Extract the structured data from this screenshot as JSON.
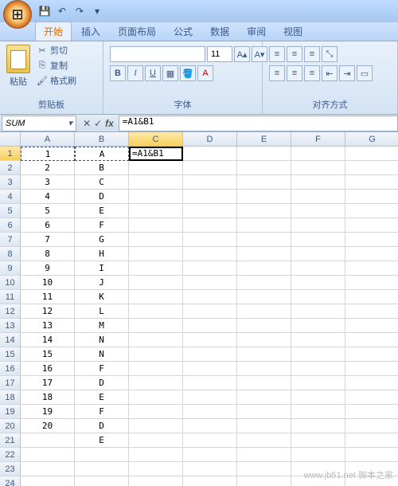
{
  "qat": {
    "save": "💾",
    "undo": "↶",
    "redo": "↷",
    "dd": "▾"
  },
  "tabs": [
    "开始",
    "插入",
    "页面布局",
    "公式",
    "数据",
    "审阅",
    "视图"
  ],
  "active_tab": 0,
  "ribbon": {
    "clipboard": {
      "title": "剪贴板",
      "paste": "粘贴",
      "cut": "剪切",
      "copy": "复制",
      "format": "格式刷"
    },
    "font": {
      "title": "字体",
      "size": "11",
      "bold": "B",
      "italic": "I",
      "underline": "U"
    },
    "align": {
      "title": "对齐方式"
    }
  },
  "name_box": "SUM",
  "formula_bar_btns": {
    "cancel": "✕",
    "ok": "✓",
    "fx": "fx"
  },
  "formula": "=A1&B1",
  "editing_cell_text": "=A1&B1",
  "columns": [
    "A",
    "B",
    "C",
    "D",
    "E",
    "F",
    "G"
  ],
  "active_col": 2,
  "active_row": 0,
  "marquee": [
    [
      0,
      0
    ],
    [
      0,
      1
    ]
  ],
  "rows": [
    {
      "n": 1,
      "c": [
        "1",
        "A",
        "",
        "",
        "",
        "",
        ""
      ]
    },
    {
      "n": 2,
      "c": [
        "2",
        "B",
        "",
        "",
        "",
        "",
        ""
      ]
    },
    {
      "n": 3,
      "c": [
        "3",
        "C",
        "",
        "",
        "",
        "",
        ""
      ]
    },
    {
      "n": 4,
      "c": [
        "4",
        "D",
        "",
        "",
        "",
        "",
        ""
      ]
    },
    {
      "n": 5,
      "c": [
        "5",
        "E",
        "",
        "",
        "",
        "",
        ""
      ]
    },
    {
      "n": 6,
      "c": [
        "6",
        "F",
        "",
        "",
        "",
        "",
        ""
      ]
    },
    {
      "n": 7,
      "c": [
        "7",
        "G",
        "",
        "",
        "",
        "",
        ""
      ]
    },
    {
      "n": 8,
      "c": [
        "8",
        "H",
        "",
        "",
        "",
        "",
        ""
      ]
    },
    {
      "n": 9,
      "c": [
        "9",
        "I",
        "",
        "",
        "",
        "",
        ""
      ]
    },
    {
      "n": 10,
      "c": [
        "10",
        "J",
        "",
        "",
        "",
        "",
        ""
      ]
    },
    {
      "n": 11,
      "c": [
        "11",
        "K",
        "",
        "",
        "",
        "",
        ""
      ]
    },
    {
      "n": 12,
      "c": [
        "12",
        "L",
        "",
        "",
        "",
        "",
        ""
      ]
    },
    {
      "n": 13,
      "c": [
        "13",
        "M",
        "",
        "",
        "",
        "",
        ""
      ]
    },
    {
      "n": 14,
      "c": [
        "14",
        "N",
        "",
        "",
        "",
        "",
        ""
      ]
    },
    {
      "n": 15,
      "c": [
        "15",
        "N",
        "",
        "",
        "",
        "",
        ""
      ]
    },
    {
      "n": 16,
      "c": [
        "16",
        "F",
        "",
        "",
        "",
        "",
        ""
      ]
    },
    {
      "n": 17,
      "c": [
        "17",
        "D",
        "",
        "",
        "",
        "",
        ""
      ]
    },
    {
      "n": 18,
      "c": [
        "18",
        "E",
        "",
        "",
        "",
        "",
        ""
      ]
    },
    {
      "n": 19,
      "c": [
        "19",
        "F",
        "",
        "",
        "",
        "",
        ""
      ]
    },
    {
      "n": 20,
      "c": [
        "20",
        "D",
        "",
        "",
        "",
        "",
        ""
      ]
    },
    {
      "n": 21,
      "c": [
        "",
        "E",
        "",
        "",
        "",
        "",
        ""
      ]
    },
    {
      "n": 22,
      "c": [
        "",
        "",
        "",
        "",
        "",
        "",
        ""
      ]
    },
    {
      "n": 23,
      "c": [
        "",
        "",
        "",
        "",
        "",
        "",
        ""
      ]
    },
    {
      "n": 24,
      "c": [
        "",
        "",
        "",
        "",
        "",
        "",
        ""
      ]
    }
  ],
  "watermark": "www.jb51.net\n脚本之家"
}
